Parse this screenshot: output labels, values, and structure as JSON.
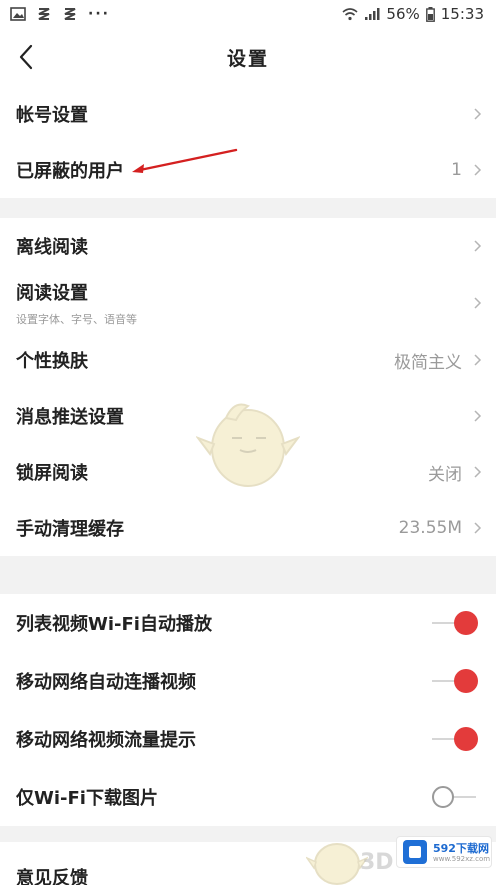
{
  "status_bar": {
    "battery": "56%",
    "time": "15:33",
    "more": "···"
  },
  "header": {
    "title": "设置"
  },
  "section1": [
    {
      "label": "帐号设置",
      "value": ""
    },
    {
      "label": "已屏蔽的用户",
      "value": "1"
    }
  ],
  "section2": [
    {
      "label": "离线阅读",
      "value": ""
    },
    {
      "label": "阅读设置",
      "sub": "设置字体、字号、语音等",
      "value": ""
    },
    {
      "label": "个性换肤",
      "value": "极简主义"
    },
    {
      "label": "消息推送设置",
      "value": ""
    },
    {
      "label": "锁屏阅读",
      "value": "关闭"
    },
    {
      "label": "手动清理缓存",
      "value": "23.55M"
    }
  ],
  "section3": [
    {
      "label": "列表视频Wi-Fi自动播放",
      "toggle": true
    },
    {
      "label": "移动网络自动连播视频",
      "toggle": true
    },
    {
      "label": "移动网络视频流量提示",
      "toggle": true
    },
    {
      "label": "仅Wi-Fi下载图片",
      "toggle": false
    }
  ],
  "section4": [
    {
      "label": "意见反馈"
    }
  ],
  "watermark": {
    "brand": "592下载网",
    "site": "www.592xz.com",
    "text3d": "3D"
  },
  "colors": {
    "accent": "#e33b3b",
    "annotation_arrow": "#d42020"
  }
}
